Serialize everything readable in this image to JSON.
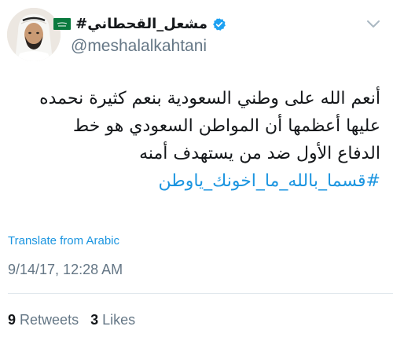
{
  "user": {
    "display_name": "#مشعل_القحطاني",
    "handle": "@meshalalkahtani",
    "verified": true
  },
  "tweet": {
    "lines": [
      "أنعم الله على وطني السعودية بنعم كثيرة نحمده",
      "عليها أعظمها أن المواطن السعودي هو خط",
      "الدفاع الأول ضد من يستهدف أمنه"
    ],
    "hashtag": "#قسما_بالله_ما_اخونك_ياوطن"
  },
  "translate_label": "Translate from Arabic",
  "timestamp": "9/14/17, 12:28 AM",
  "stats": {
    "retweets_count": "9",
    "retweets_label": "Retweets",
    "likes_count": "3",
    "likes_label": "Likes"
  },
  "colors": {
    "link": "#1b95e0",
    "muted": "#657786",
    "divider": "#e1e8ed",
    "flag_green": "#0a7a3e"
  },
  "icons": {
    "menu": "chevron-down-icon",
    "verified": "verified-badge-icon",
    "flag": "saudi-flag-icon"
  }
}
